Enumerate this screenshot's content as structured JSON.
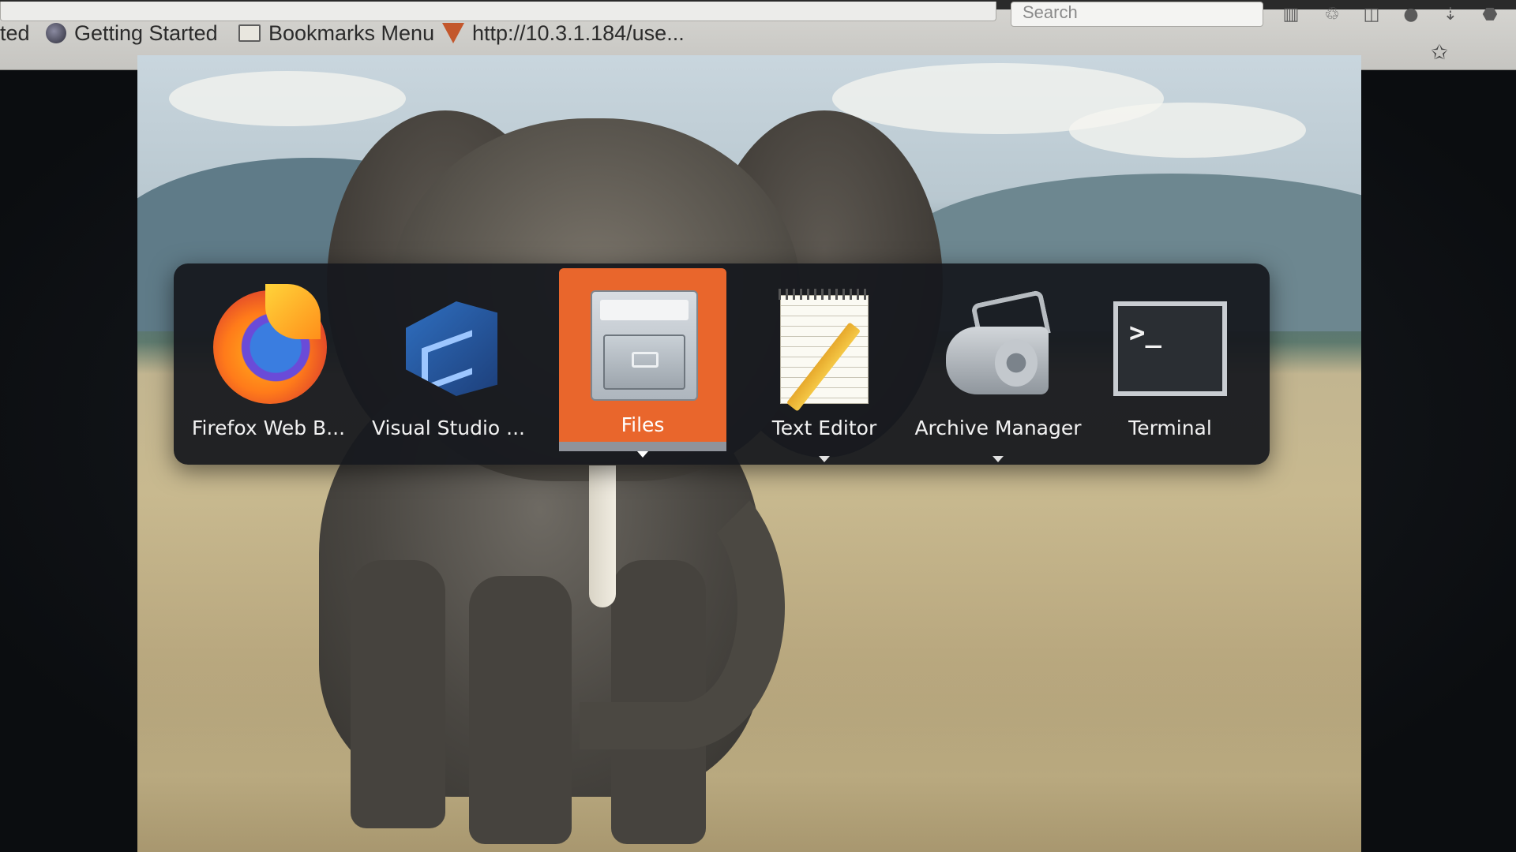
{
  "browser": {
    "search_placeholder": "Search",
    "bookmarks": [
      {
        "label": "ted",
        "icon": "tab-overflow"
      },
      {
        "label": "Getting Started",
        "icon": "firefox-favicon-icon"
      },
      {
        "label": "Bookmarks Menu",
        "icon": "folder-icon"
      },
      {
        "label": "http://10.3.1.184/use...",
        "icon": "firefox-fox-icon"
      }
    ]
  },
  "switcher": {
    "apps": [
      {
        "label": "Firefox Web B...",
        "icon": "firefox-icon",
        "selected": false,
        "running": false
      },
      {
        "label": "Visual Studio ...",
        "icon": "vscode-icon",
        "selected": false,
        "running": false
      },
      {
        "label": "Files",
        "icon": "files-icon",
        "selected": true,
        "running": true
      },
      {
        "label": "Text Editor",
        "icon": "text-editor-icon",
        "selected": false,
        "running": true
      },
      {
        "label": "Archive Manager",
        "icon": "archive-manager-icon",
        "selected": false,
        "running": true
      },
      {
        "label": "Terminal",
        "icon": "terminal-icon",
        "selected": false,
        "running": false
      }
    ],
    "accent": "#e9662c"
  },
  "terminal_prompt": ">_"
}
